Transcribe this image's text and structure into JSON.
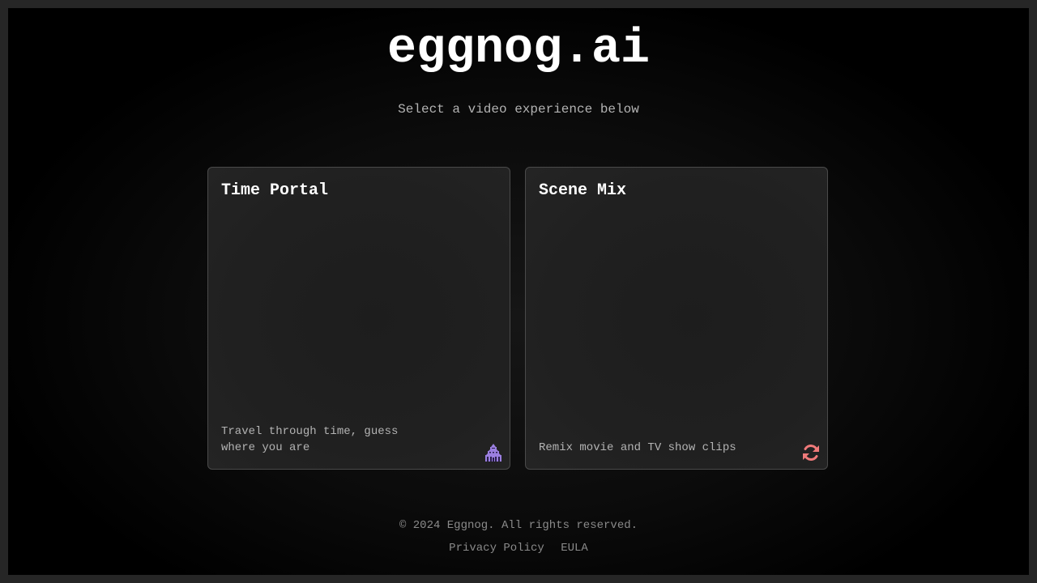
{
  "header": {
    "logo": "eggnog.ai",
    "subtitle": "Select a video experience below"
  },
  "cards": [
    {
      "title": "Time Portal",
      "description": "Travel through time, guess where you are",
      "icon": "temple-icon",
      "icon_color": "#9b7fe0"
    },
    {
      "title": "Scene Mix",
      "description": "Remix movie and TV show clips",
      "icon": "refresh-icon",
      "icon_color": "#f07a7a"
    }
  ],
  "footer": {
    "copyright": "© 2024 Eggnog. All rights reserved.",
    "links": [
      "Privacy Policy",
      "EULA"
    ]
  },
  "colors": {
    "background": "#000000",
    "card_border": "#4a4a4a",
    "text_primary": "#ffffff",
    "text_secondary": "#b3b3b3",
    "text_muted": "#8a8a8a"
  }
}
